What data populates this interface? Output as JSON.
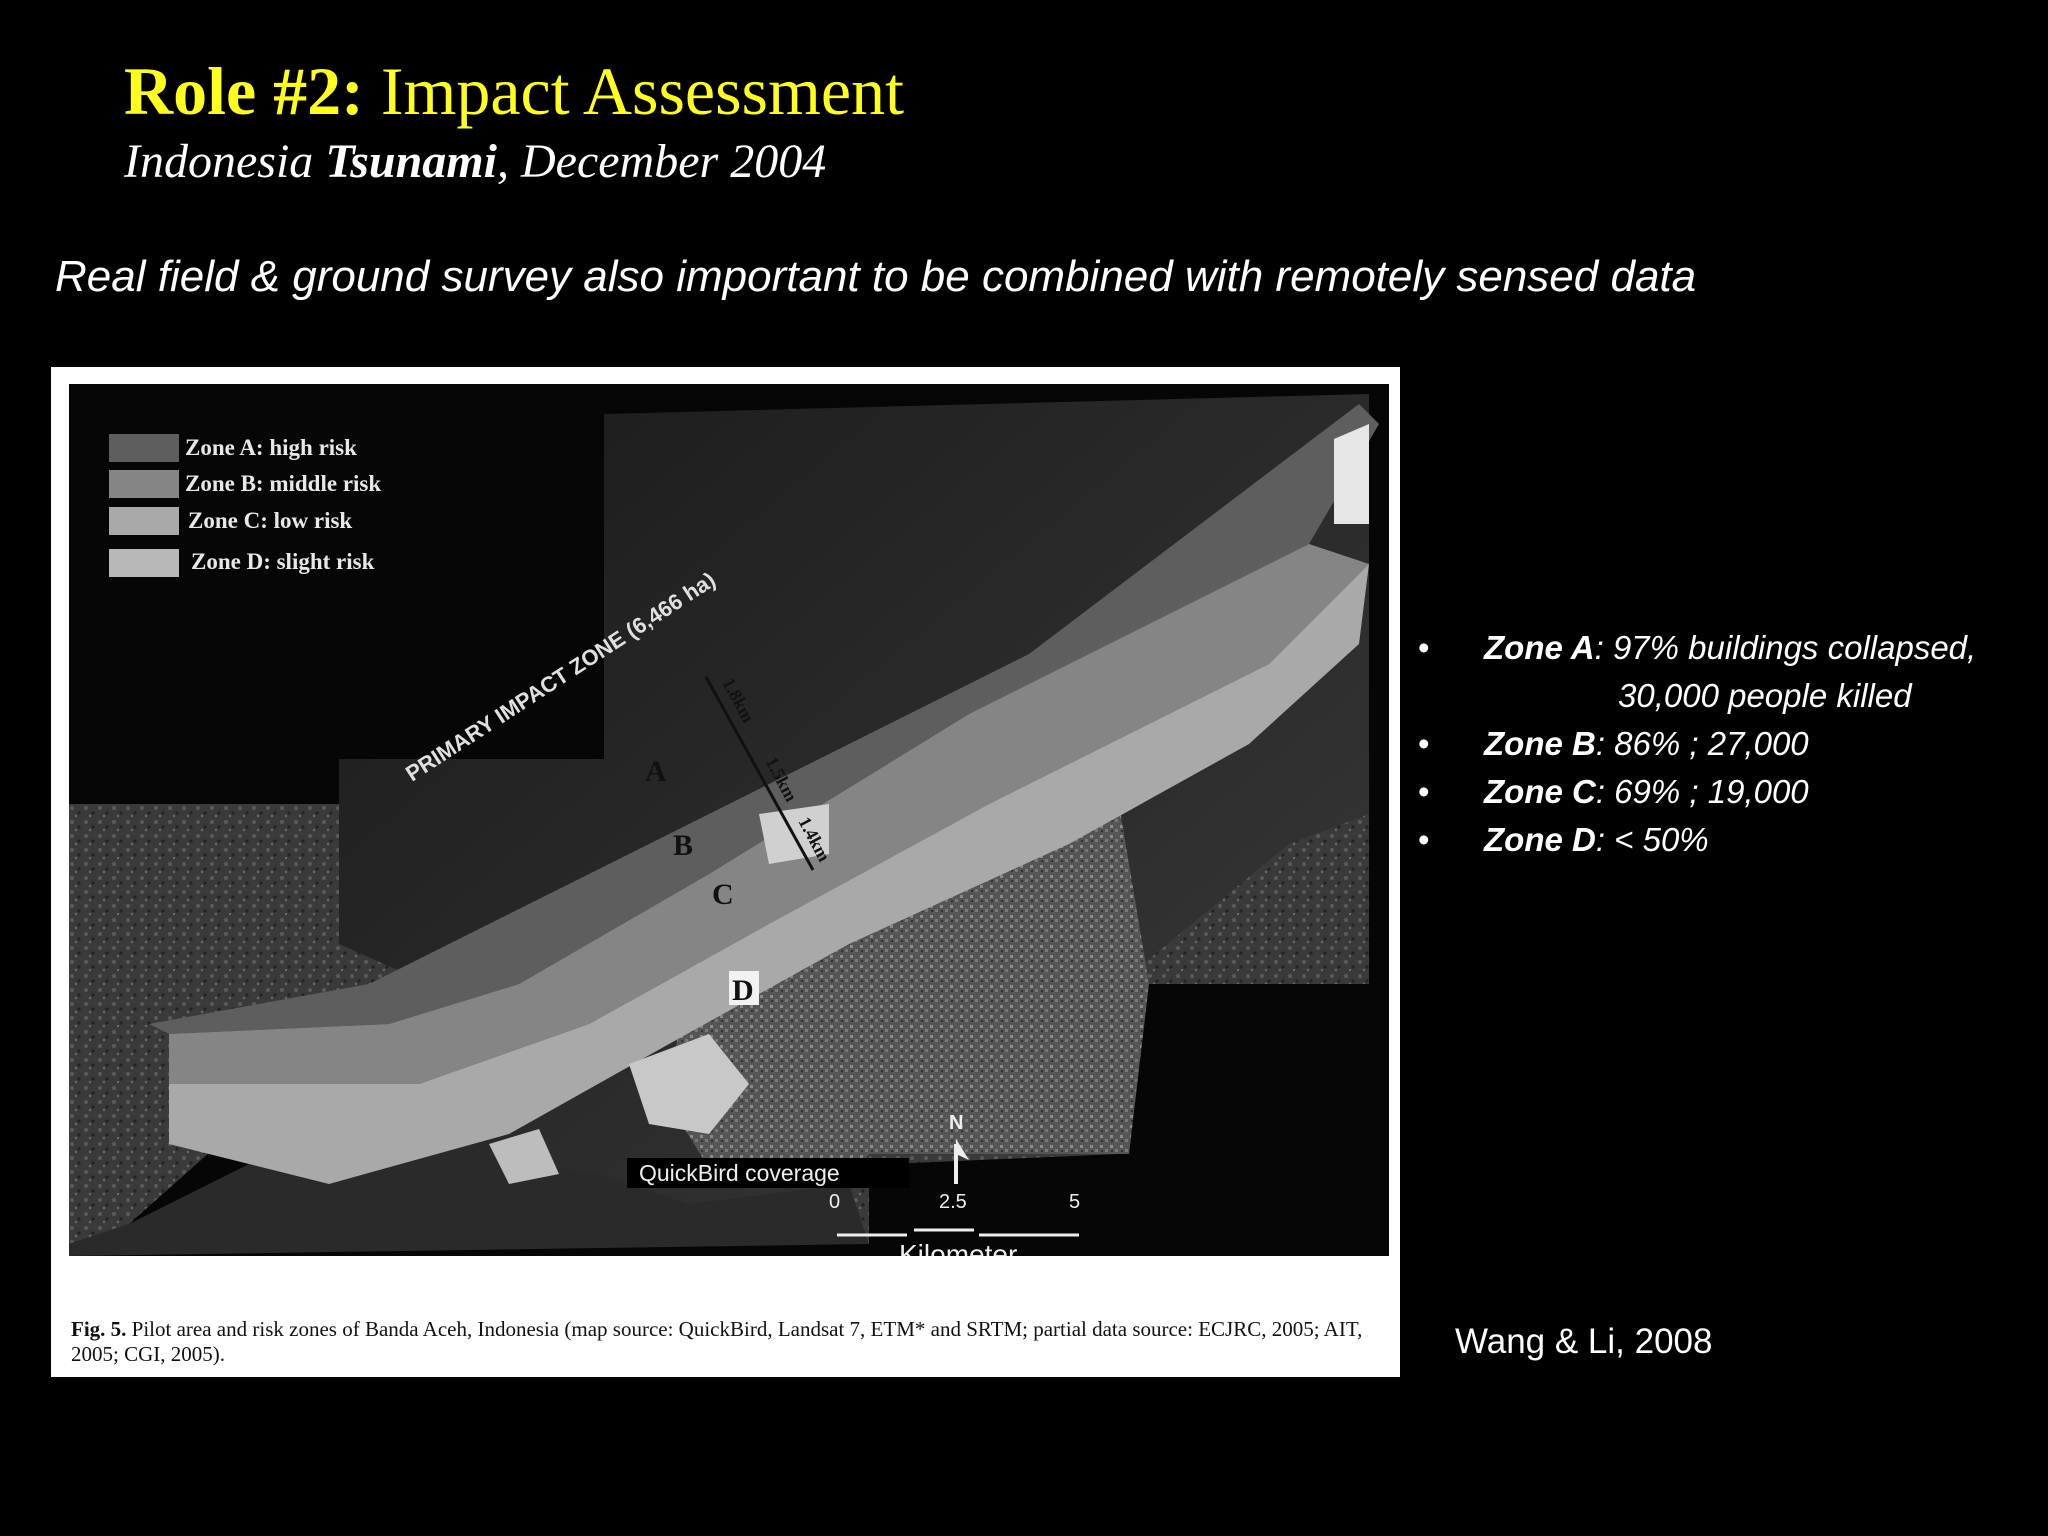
{
  "slide": {
    "title_bold": "Role #2:",
    "title_rest": " Impact Assessment",
    "subtitle_prefix": "Indonesia ",
    "subtitle_bold": "Tsunami",
    "subtitle_suffix": ", December 2004",
    "lead": "Real field & ground survey also important to be combined with remotely sensed data"
  },
  "figure": {
    "legend": [
      "Zone A: high risk",
      "Zone B: middle risk",
      "Zone C: low risk",
      "Zone D: slight risk"
    ],
    "zone_labels": [
      "A",
      "B",
      "C",
      "D"
    ],
    "impact_label": "PRIMARY IMPACT ZONE (6,466 ha)",
    "distances": [
      "1.8km",
      "1.5km",
      "1.4km"
    ],
    "coverage_label": "QuickBird coverage",
    "north": "N",
    "scale": [
      "0",
      "2.5",
      "5"
    ],
    "scale_unit": "Kilometer",
    "caption_label": "Fig. 5.",
    "caption_text": " Pilot area and risk zones of Banda Aceh, Indonesia (map source: QuickBird, Landsat 7, ETM* and SRTM; partial data source: ECJRC, 2005; AIT, 2005; CGI, 2005)."
  },
  "zones": [
    {
      "name": "Zone A",
      "text": ": 97% buildings collapsed,"
    },
    {
      "cont": "30,000 people killed"
    },
    {
      "name": "Zone B",
      "text": ": 86% ; 27,000"
    },
    {
      "name": "Zone C",
      "text": ": 69% ; 19,000"
    },
    {
      "name": "Zone D",
      "text": ": < 50%"
    }
  ],
  "bullet_char": "•",
  "credit": "Wang & Li, 2008"
}
